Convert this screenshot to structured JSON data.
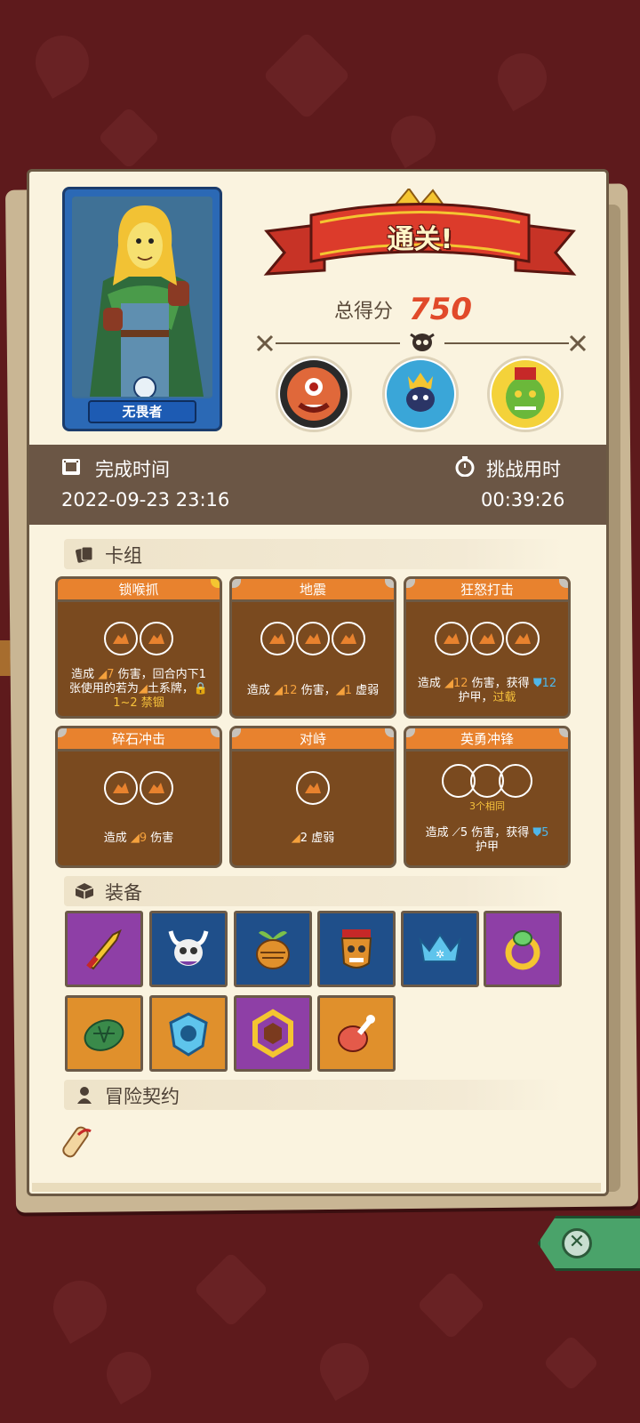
{
  "hero": {
    "name": "无畏者"
  },
  "result": {
    "banner": "通关!",
    "score_label": "总得分",
    "score_value": "750"
  },
  "bosses": [
    {
      "icon": "cyclops-boss-icon"
    },
    {
      "icon": "crowned-spirit-boss-icon"
    },
    {
      "icon": "green-demon-boss-icon"
    }
  ],
  "time": {
    "finish_label": "完成时间",
    "finish_value": "2022-09-23 23:16",
    "challenge_label": "挑战用时",
    "challenge_value": "00:39:26"
  },
  "deck": {
    "title": "卡组",
    "cards": [
      {
        "name": "锁喉抓",
        "line1": "造成 ",
        "dmg": "7",
        "line1b": " 伤害，回合内下1",
        "line2": "张使用的若为",
        "type": "土系牌",
        "line3": "1~2 禁锢"
      },
      {
        "name": "地震",
        "p1": "造成 ",
        "v1": "12",
        "p2": " 伤害，",
        "v2": "1",
        "p3": " 虚弱"
      },
      {
        "name": "狂怒打击",
        "p1": "造成 ",
        "v1": "12",
        "p2": " 伤害，获得 ",
        "v2": "12",
        "p3": "护甲，",
        "v3": "过载"
      },
      {
        "name": "碎石冲击",
        "p1": "造成 ",
        "v1": "9",
        "p2": " 伤害"
      },
      {
        "name": "对峙",
        "v1": "2",
        "p1": " 虚弱"
      },
      {
        "name": "英勇冲锋",
        "note": "3个相同",
        "p1": "造成 ",
        "v1": "5",
        "p2": " 伤害，获得 ",
        "v2": "5",
        "p3": "护甲"
      }
    ]
  },
  "equipment": {
    "title": "装备",
    "items": [
      {
        "icon": "golden-dagger-icon",
        "bg": "#8e3fa6"
      },
      {
        "icon": "horned-skull-icon",
        "bg": "#1f4f8a"
      },
      {
        "icon": "turnip-icon",
        "bg": "#1f4f8a"
      },
      {
        "icon": "tribal-mask-icon",
        "bg": "#1f4f8a"
      },
      {
        "icon": "ice-crown-icon",
        "bg": "#1f4f8a"
      },
      {
        "icon": "jeweled-ring-icon",
        "bg": "#8e3fa6"
      },
      {
        "icon": "turtle-shell-icon",
        "bg": "#e0902c"
      },
      {
        "icon": "skull-shield-icon",
        "bg": "#e0902c"
      },
      {
        "icon": "hex-amulet-icon",
        "bg": "#8e3fa6"
      },
      {
        "icon": "meat-leg-icon",
        "bg": "#e0902c"
      }
    ]
  },
  "contract": {
    "title": "冒险契约"
  }
}
